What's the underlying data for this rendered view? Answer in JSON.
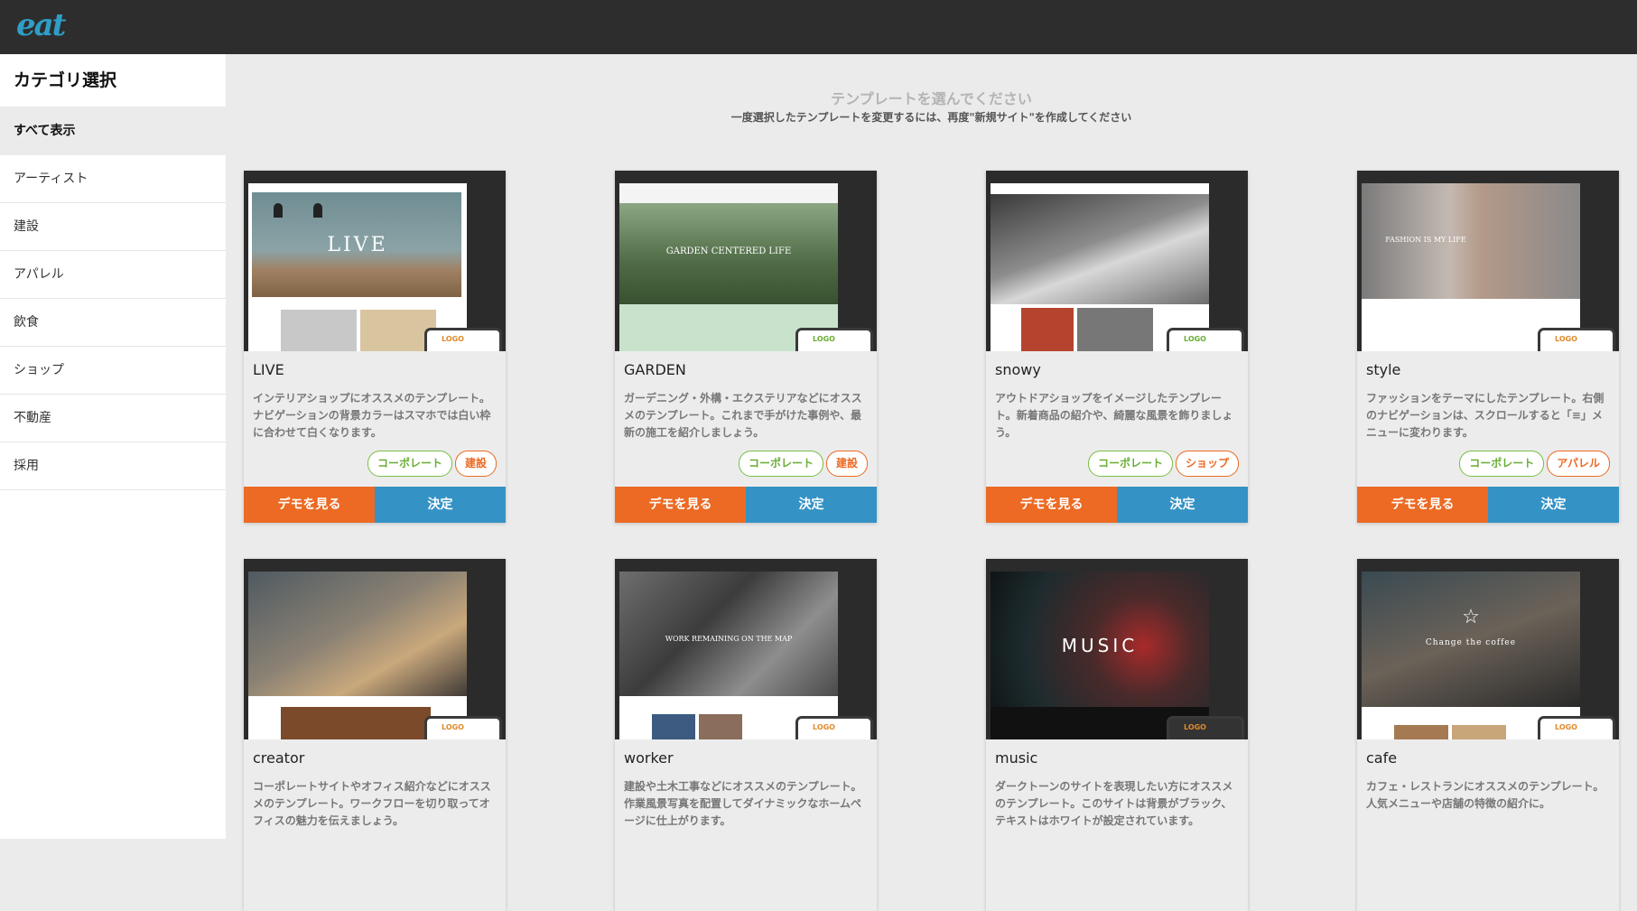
{
  "app": {
    "logo": "eat"
  },
  "sidebar": {
    "title": "カテゴリ選択",
    "items": [
      {
        "label": "すべて表示",
        "active": true
      },
      {
        "label": "アーティスト"
      },
      {
        "label": "建設"
      },
      {
        "label": "アパレル"
      },
      {
        "label": "飲食"
      },
      {
        "label": "ショップ"
      },
      {
        "label": "不動産"
      },
      {
        "label": "採用"
      }
    ]
  },
  "main": {
    "title": "テンプレートを選んでください",
    "subtitle": "一度選択したテンプレートを変更するには、再度\"新規サイト\"を作成してください"
  },
  "buttons": {
    "demo": "デモを見る",
    "select": "決定"
  },
  "templates": [
    {
      "name": "LIVE",
      "desc": "インテリアショップにオススメのテンプレート。ナビゲーションの背景カラーはスマホでは白い枠に合わせて白くなります。",
      "tags": [
        "コーポレート",
        "建設"
      ],
      "hero": "LIVE"
    },
    {
      "name": "GARDEN",
      "desc": "ガーデニング・外構・エクステリアなどにオススメのテンプレート。これまで手がけた事例や、最新の施工を紹介しましょう。",
      "tags": [
        "コーポレート",
        "建設"
      ],
      "hero": "GARDEN CENTERED LIFE"
    },
    {
      "name": "snowy",
      "desc": "アウトドアショップをイメージしたテンプレート。新着商品の紹介や、綺麗な風景を飾りましょう。",
      "tags": [
        "コーポレート",
        "ショップ"
      ],
      "hero": ""
    },
    {
      "name": "style",
      "desc": "ファッションをテーマにしたテンプレート。右側のナビゲーションは、スクロールすると「≡」メニューに変わります。",
      "tags": [
        "コーポレート",
        "アパレル"
      ],
      "hero": "FASHION IS MY LIFE"
    },
    {
      "name": "creator",
      "desc": "コーポレートサイトやオフィス紹介などにオススメのテンプレート。ワークフローを切り取ってオフィスの魅力を伝えましょう。",
      "tags": [],
      "hero": ""
    },
    {
      "name": "worker",
      "desc": "建設や土木工事などにオススメのテンプレート。作業風景写真を配置してダイナミックなホームページに仕上がります。",
      "tags": [],
      "hero": "WORK REMAINING ON THE MAP"
    },
    {
      "name": "music",
      "desc": "ダークトーンのサイトを表現したい方にオススメのテンプレート。このサイトは背景がブラック、テキストはホワイトが設定されています。",
      "tags": [],
      "hero": "MUSIC"
    },
    {
      "name": "cafe",
      "desc": "カフェ・レストランにオススメのテンプレート。人気メニューや店舗の特徴の紹介に。",
      "tags": [],
      "hero": "Change the coffee"
    }
  ],
  "thumb_logo": "LOGO"
}
